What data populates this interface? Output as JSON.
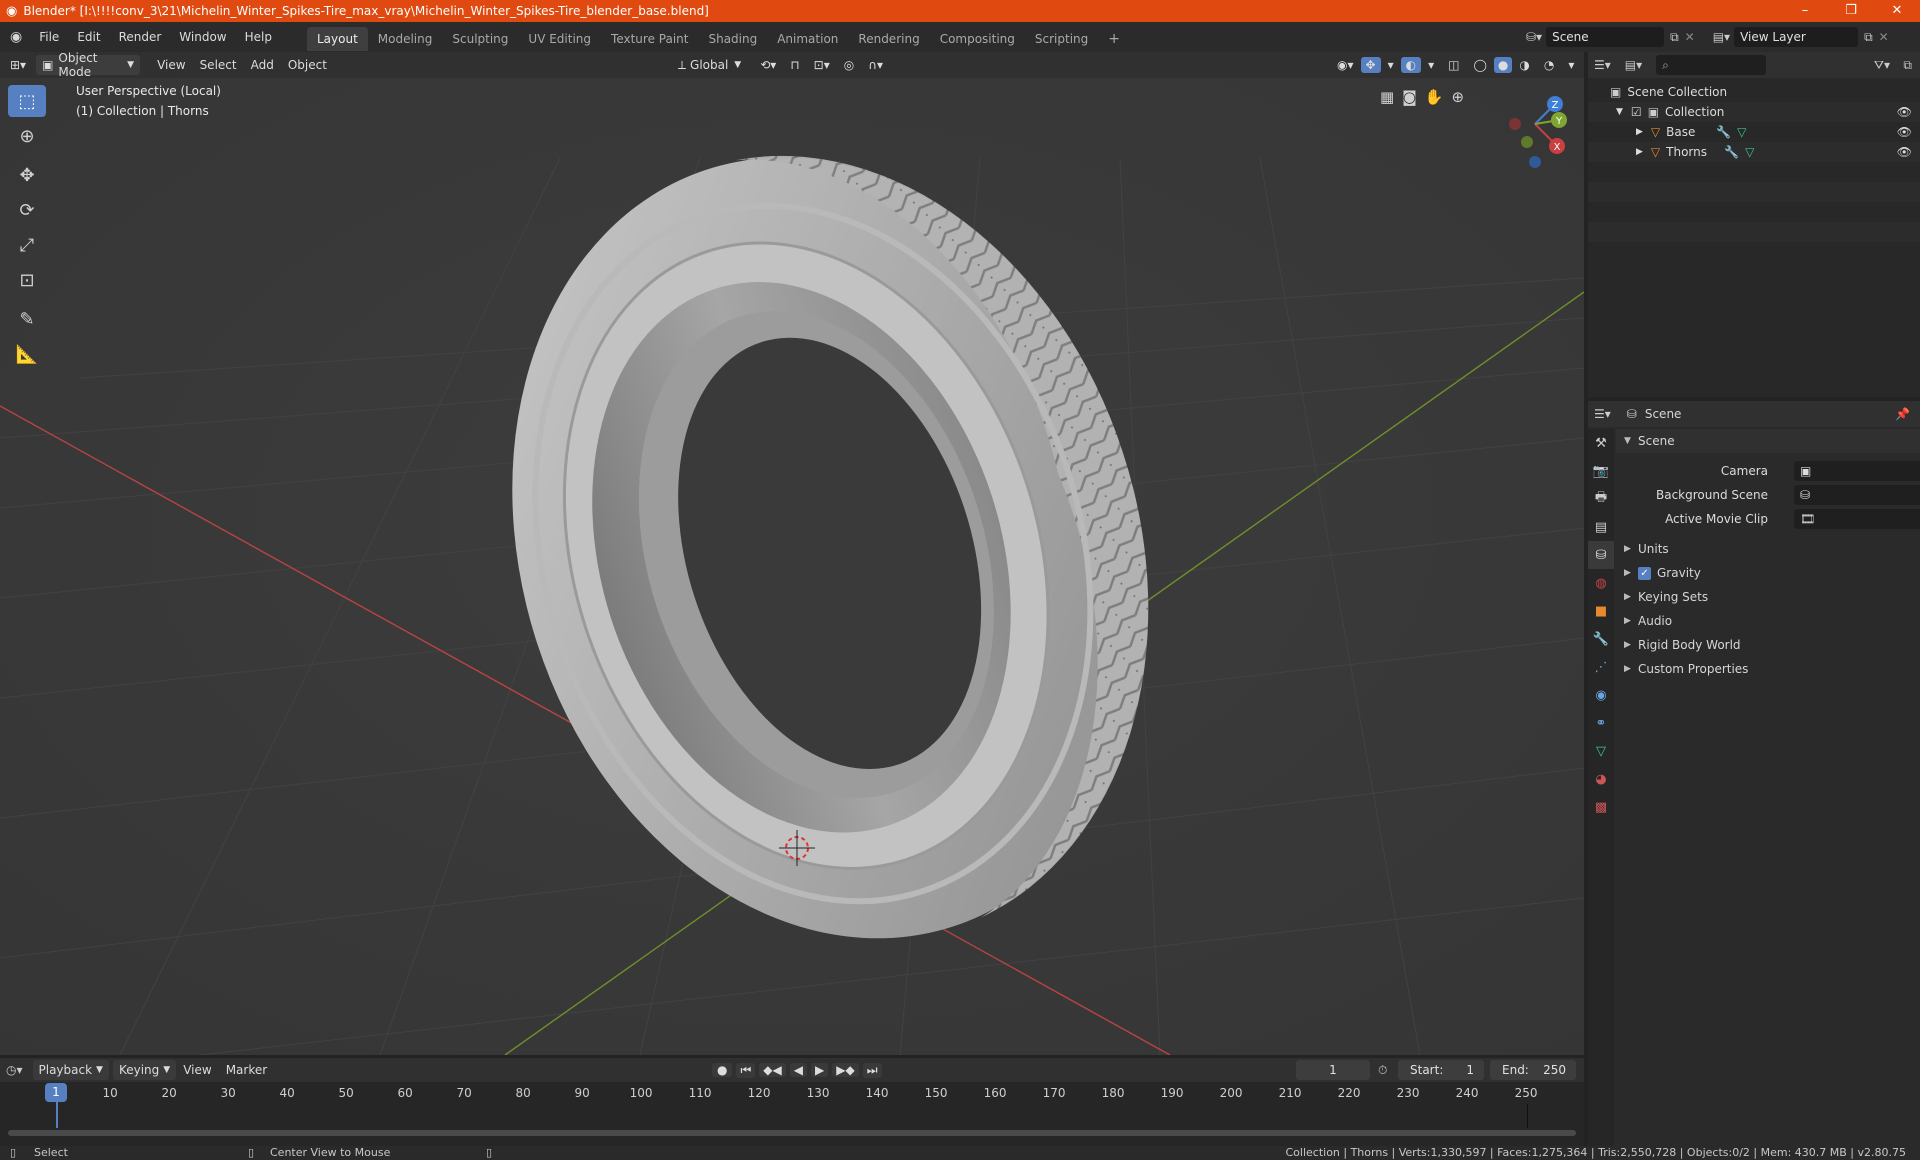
{
  "window": {
    "title": "Blender* [I:\\!!!!conv_3\\21\\Michelin_Winter_Spikes-Tire_max_vray\\Michelin_Winter_Spikes-Tire_blender_base.blend]",
    "minimize": "–",
    "restore": "❐",
    "close": "✕"
  },
  "menu": [
    "File",
    "Edit",
    "Render",
    "Window",
    "Help"
  ],
  "workspaces": {
    "tabs": [
      "Layout",
      "Modeling",
      "Sculpting",
      "UV Editing",
      "Texture Paint",
      "Shading",
      "Animation",
      "Rendering",
      "Compositing",
      "Scripting"
    ],
    "add": "+"
  },
  "scene_selector": {
    "value": "Scene"
  },
  "view_layer_selector": {
    "value": "View Layer"
  },
  "viewport_header": {
    "mode": "Object Mode",
    "menus": [
      "View",
      "Select",
      "Add",
      "Object"
    ],
    "orientation": "Global"
  },
  "viewport": {
    "info_line1": "User Perspective (Local)",
    "info_line2": "(1) Collection | Thorns",
    "gizmo_axes": {
      "x": "X",
      "y": "Y",
      "z": "Z"
    }
  },
  "outliner": {
    "search_placeholder": "",
    "root": "Scene Collection",
    "collection": "Collection",
    "objects": [
      "Base",
      "Thorns"
    ]
  },
  "properties": {
    "context": "Scene",
    "panel": "Scene",
    "fields": {
      "camera": "Camera",
      "background_scene": "Background Scene",
      "active_movie_clip": "Active Movie Clip"
    },
    "subpanels": [
      "Units",
      "Gravity",
      "Keying Sets",
      "Audio",
      "Rigid Body World",
      "Custom Properties"
    ],
    "gravity_checked": true
  },
  "timeline": {
    "menus": [
      "Playback",
      "Keying",
      "View",
      "Marker"
    ],
    "current_frame": "1",
    "start_label": "Start:",
    "start": "1",
    "end_label": "End:",
    "end": "250",
    "ticks": [
      "10",
      "20",
      "30",
      "40",
      "50",
      "60",
      "70",
      "80",
      "90",
      "100",
      "110",
      "120",
      "130",
      "140",
      "150",
      "160",
      "170",
      "180",
      "190",
      "200",
      "210",
      "220",
      "230",
      "240",
      "250"
    ]
  },
  "statusbar": {
    "left": "Select",
    "middle": "Center View to Mouse",
    "right": "Collection | Thorns | Verts:1,330,597 | Faces:1,275,364 | Tris:2,550,728 | Objects:0/2 | Mem: 430.7 MB | v2.80.75"
  },
  "colors": {
    "title_bar": "#e0490f",
    "accent_blue": "#5680c2",
    "axis_x": "#c94040",
    "axis_y": "#7fa630",
    "axis_z": "#3f7fd6"
  }
}
